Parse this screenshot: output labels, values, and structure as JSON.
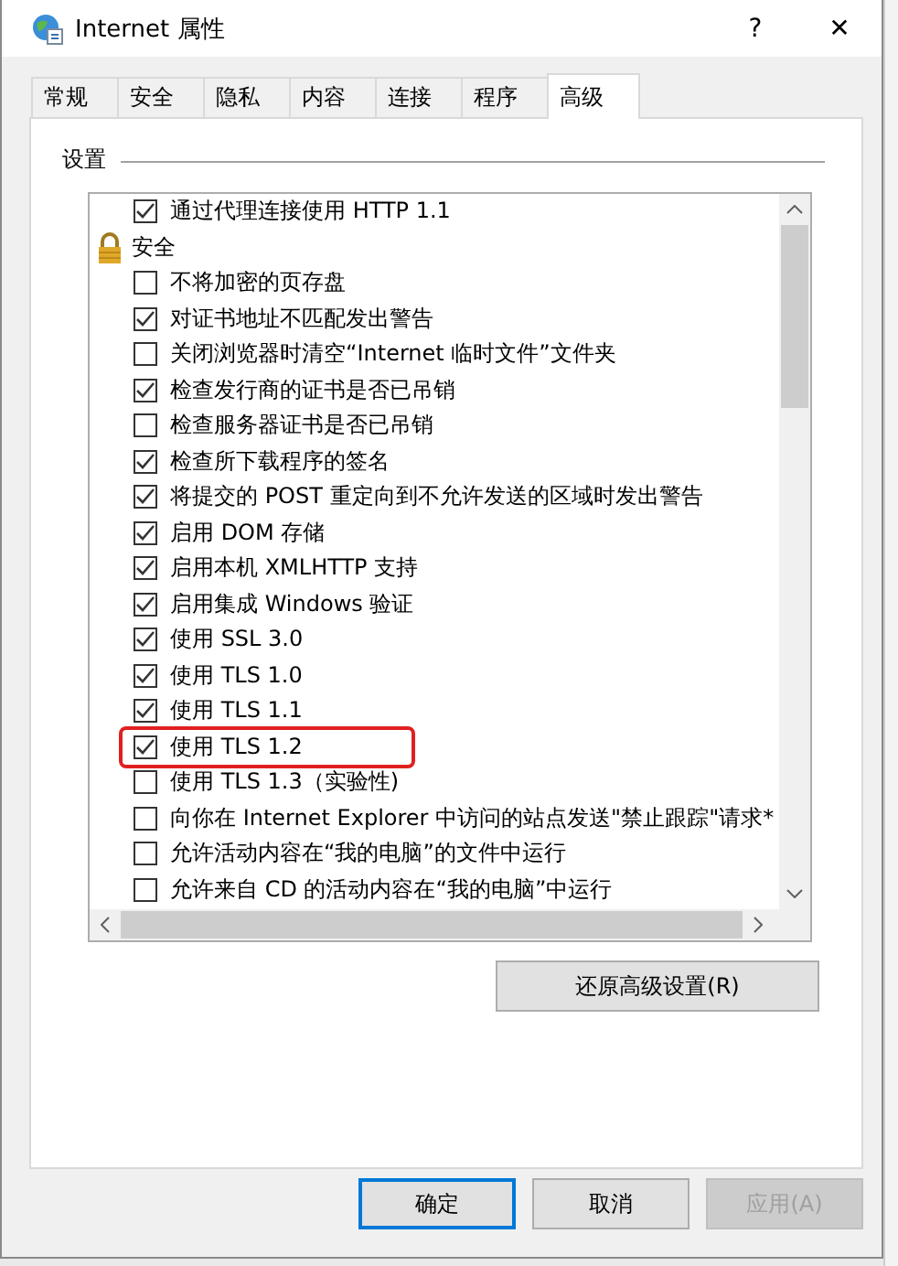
{
  "window": {
    "title": "Internet 属性",
    "help": "?",
    "close": "✕"
  },
  "tabs": [
    {
      "label": "常规",
      "selected": false
    },
    {
      "label": "安全",
      "selected": false
    },
    {
      "label": "隐私",
      "selected": false
    },
    {
      "label": "内容",
      "selected": false
    },
    {
      "label": "连接",
      "selected": false
    },
    {
      "label": "程序",
      "selected": false
    },
    {
      "label": "高级",
      "selected": true
    }
  ],
  "settings": {
    "label": "设置",
    "items": [
      {
        "kind": "checkbox",
        "label": "通过代理连接使用 HTTP 1.1",
        "checked": true,
        "highlighted": false
      },
      {
        "kind": "group",
        "label": "安全"
      },
      {
        "kind": "checkbox",
        "label": "不将加密的页存盘",
        "checked": false,
        "highlighted": false
      },
      {
        "kind": "checkbox",
        "label": "对证书地址不匹配发出警告",
        "checked": true,
        "highlighted": false
      },
      {
        "kind": "checkbox",
        "label": "关闭浏览器时清空“Internet 临时文件”文件夹",
        "checked": false,
        "highlighted": false
      },
      {
        "kind": "checkbox",
        "label": "检查发行商的证书是否已吊销",
        "checked": true,
        "highlighted": false
      },
      {
        "kind": "checkbox",
        "label": "检查服务器证书是否已吊销",
        "checked": false,
        "highlighted": false
      },
      {
        "kind": "checkbox",
        "label": "检查所下载程序的签名",
        "checked": true,
        "highlighted": false
      },
      {
        "kind": "checkbox",
        "label": "将提交的 POST 重定向到不允许发送的区域时发出警告",
        "checked": true,
        "highlighted": false
      },
      {
        "kind": "checkbox",
        "label": "启用 DOM 存储",
        "checked": true,
        "highlighted": false
      },
      {
        "kind": "checkbox",
        "label": "启用本机 XMLHTTP 支持",
        "checked": true,
        "highlighted": false
      },
      {
        "kind": "checkbox",
        "label": "启用集成 Windows 验证",
        "checked": true,
        "highlighted": false
      },
      {
        "kind": "checkbox",
        "label": "使用 SSL 3.0",
        "checked": true,
        "highlighted": false
      },
      {
        "kind": "checkbox",
        "label": "使用 TLS 1.0",
        "checked": true,
        "highlighted": false
      },
      {
        "kind": "checkbox",
        "label": "使用 TLS 1.1",
        "checked": true,
        "highlighted": false
      },
      {
        "kind": "checkbox",
        "label": "使用 TLS 1.2",
        "checked": true,
        "highlighted": true
      },
      {
        "kind": "checkbox",
        "label": "使用 TLS 1.3（实验性)",
        "checked": false,
        "highlighted": false
      },
      {
        "kind": "checkbox",
        "label": "向你在 Internet Explorer 中访问的站点发送\"禁止跟踪\"请求*",
        "checked": false,
        "highlighted": false
      },
      {
        "kind": "checkbox",
        "label": "允许活动内容在“我的电脑”的文件中运行",
        "checked": false,
        "highlighted": false
      },
      {
        "kind": "checkbox",
        "label": "允许来自 CD 的活动内容在“我的电脑”中运行",
        "checked": false,
        "highlighted": false
      }
    ]
  },
  "restore_button": "还原高级设置(R)",
  "buttons": [
    {
      "label": "确定",
      "kind": "default",
      "disabled": false
    },
    {
      "label": "取消",
      "kind": "normal",
      "disabled": false
    },
    {
      "label": "应用(A)",
      "kind": "normal",
      "disabled": true
    }
  ]
}
